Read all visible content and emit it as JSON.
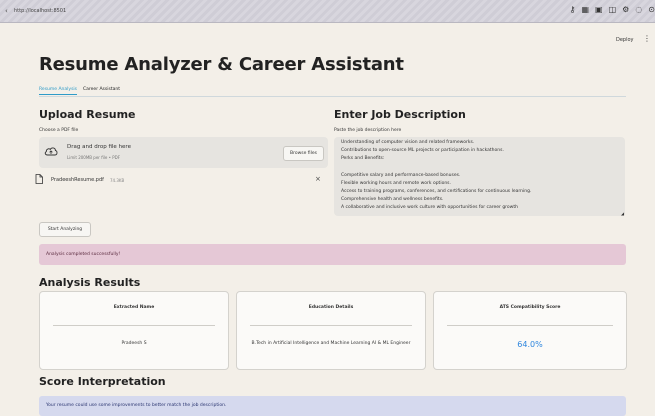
{
  "browser": {
    "url": "http://localhost:8501"
  },
  "header": {
    "deploy_label": "Deploy",
    "menu_glyph": "⋮"
  },
  "app": {
    "title": "Resume Analyzer & Career Assistant",
    "tabs": [
      {
        "label": "Resume Analysis",
        "active": true
      },
      {
        "label": "Career Assistant",
        "active": false
      }
    ]
  },
  "upload": {
    "heading": "Upload Resume",
    "label": "Choose a PDF file",
    "drop_title": "Drag and drop file here",
    "drop_limit": "Limit 200MB per file • PDF",
    "browse_label": "Browse files",
    "file_name": "PradeeshResume.pdf",
    "file_size": "74.3KB",
    "remove_glyph": "×"
  },
  "job": {
    "heading": "Enter Job Description",
    "label": "Paste the job description here",
    "lines": [
      "Understanding of computer vision and related frameworks.",
      "Contributions to open-source ML projects or participation in hackathons.",
      "Perks and Benefits:",
      "",
      "Competitive salary and performance-based bonuses.",
      "Flexible working hours and remote work options.",
      "Access to training programs, conferences, and certifications for continuous learning.",
      "Comprehensive health and wellness benefits.",
      "A collaborative and inclusive work culture with opportunities for career growth"
    ]
  },
  "actions": {
    "start_label": "Start Analyzing",
    "success_message": "Analysis completed successfully!"
  },
  "results": {
    "heading": "Analysis Results",
    "cards": [
      {
        "title": "Extracted Name",
        "value": "Pradeesh S"
      },
      {
        "title": "Education Details",
        "value": "B.Tech in Artificial Intelligence and Machine Learning AI & ML Engineer"
      },
      {
        "title": "ATS Compatibility Score",
        "value": "64.0%"
      }
    ]
  },
  "interpretation": {
    "heading": "Score Interpretation",
    "message": "Your resume could use some improvements to better match the job description."
  },
  "colors": {
    "accent": "#2e9bc8",
    "score": "#2e86de",
    "success_bg": "#e5c8d6",
    "info_bg": "#d5d9ee"
  }
}
